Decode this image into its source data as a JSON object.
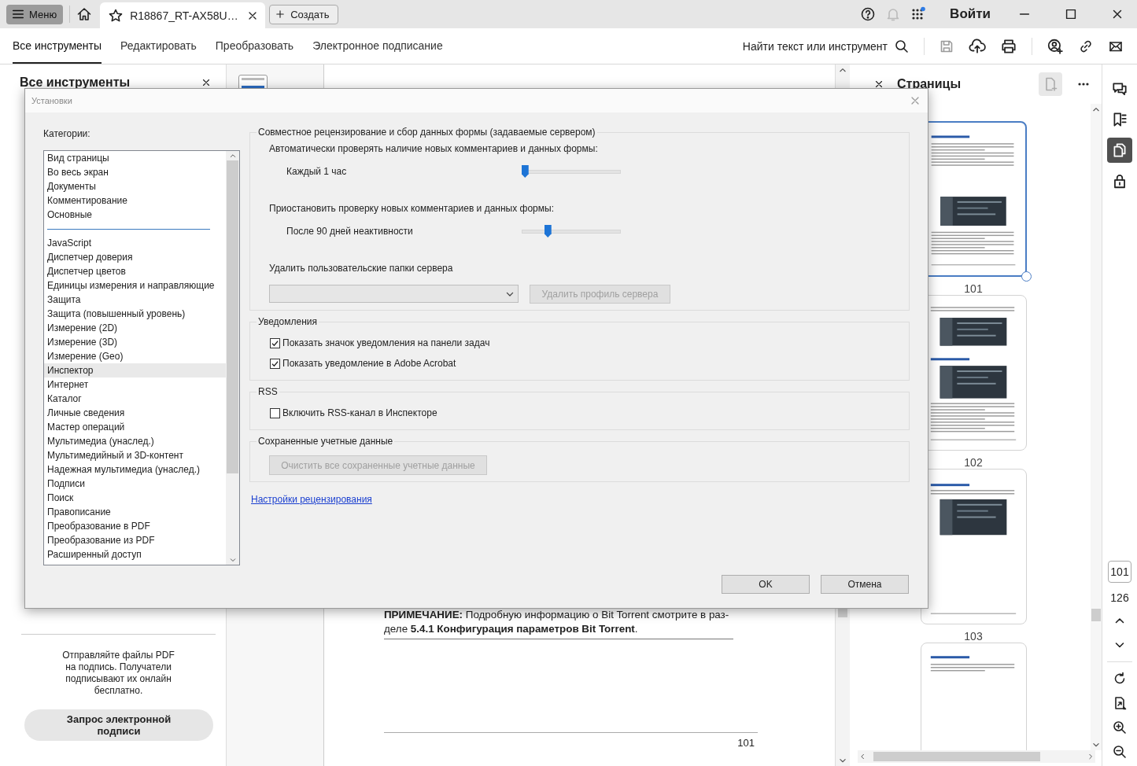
{
  "title_bar": {
    "menu_button": "Меню",
    "tab": {
      "title": "R18867_RT-AX58U…"
    },
    "create_button": "Создать",
    "sign_in": "Войти"
  },
  "toolbar": {
    "tabs": [
      {
        "label": "Все инструменты",
        "selected": true
      },
      {
        "label": "Редактировать",
        "selected": false
      },
      {
        "label": "Преобразовать",
        "selected": false
      },
      {
        "label": "Электронное подписание",
        "selected": false
      }
    ],
    "search": "Найти текст или инструмент"
  },
  "left_panel": {
    "title": "Все инструменты",
    "promo_text": "Отправляйте файлы PDF на подпись. Получатели подписывают их онлайн бесплатно.",
    "request_button": "Запрос электронной подписи"
  },
  "document": {
    "note": "**ПРИМЕЧАНИЕ:** Подробную информацию о Bit Torrent смотрите в раз-деле **5.4.1 Конфигурация параметров Bit Torrent**.",
    "page_number": "101"
  },
  "pages_panel": {
    "title": "Страницы",
    "pages": [
      {
        "number": "101",
        "selected": true
      },
      {
        "number": "102",
        "selected": false
      },
      {
        "number": "103",
        "selected": false
      },
      {
        "selected": false
      }
    ]
  },
  "rail": {
    "tools": [
      {
        "kind": "comments",
        "selected": false
      },
      {
        "kind": "bookmarks",
        "selected": false
      },
      {
        "kind": "pages",
        "selected": true
      },
      {
        "kind": "security",
        "selected": false
      }
    ],
    "page_field": "101",
    "page_count": "126"
  },
  "dialog": {
    "title": "Установки",
    "categories_label": "Категории:",
    "category_groups": [
      {
        "items": [
          {
            "label": "Вид страницы",
            "selected": false
          },
          {
            "label": "Во весь экран",
            "selected": false
          },
          {
            "label": "Документы",
            "selected": false
          },
          {
            "label": "Комментирование",
            "selected": false
          },
          {
            "label": "Основные",
            "selected": false
          }
        ]
      },
      {
        "items": [
          {
            "label": "JavaScript",
            "selected": false
          },
          {
            "label": "Диспетчер доверия",
            "selected": false
          },
          {
            "label": "Диспетчер цветов",
            "selected": false
          },
          {
            "label": "Единицы измерения и направляющие",
            "selected": false
          },
          {
            "label": "Защита",
            "selected": false
          },
          {
            "label": "Защита (повышенный уровень)",
            "selected": false
          },
          {
            "label": "Измерение (2D)",
            "selected": false
          },
          {
            "label": "Измерение (3D)",
            "selected": false
          },
          {
            "label": "Измерение (Geo)",
            "selected": false
          },
          {
            "label": "Инспектор",
            "selected": true
          },
          {
            "label": "Интернет",
            "selected": false
          },
          {
            "label": "Каталог",
            "selected": false
          },
          {
            "label": "Личные сведения",
            "selected": false
          },
          {
            "label": "Мастер операций",
            "selected": false
          },
          {
            "label": "Мультимедиа (унаслед.)",
            "selected": false
          },
          {
            "label": "Мультимедийный и 3D-контент",
            "selected": false
          },
          {
            "label": "Надежная мультимедиа (унаслед.)",
            "selected": false
          },
          {
            "label": "Подписи",
            "selected": false
          },
          {
            "label": "Поиск",
            "selected": false
          },
          {
            "label": "Правописание",
            "selected": false
          },
          {
            "label": "Преобразование в PDF",
            "selected": false
          },
          {
            "label": "Преобразование из PDF",
            "selected": false
          },
          {
            "label": "Расширенный доступ",
            "selected": false
          }
        ]
      }
    ],
    "sections": [
      {
        "legend": "Совместное рецензирование и сбор данных формы (задаваемые сервером)",
        "rows": [
          {
            "kind": "text",
            "text": "Автоматически проверять наличие новых комментариев и данных формы:"
          },
          {
            "kind": "slider",
            "label": "Каждый 1 час",
            "level": 0.03
          },
          {
            "kind": "text",
            "text": "Приостановить проверку новых комментариев и данных формы:"
          },
          {
            "kind": "slider",
            "label": "После 90 дней неактивности",
            "level": 0.26
          },
          {
            "kind": "text",
            "text": "Удалить пользовательские папки сервера"
          },
          {
            "kind": "select_button",
            "disabled": true,
            "button": "Удалить профиль сервера"
          }
        ]
      },
      {
        "legend": "Уведомления",
        "rows": [
          {
            "kind": "checkbox",
            "label": "Показать значок уведомления на панели задач",
            "checked": true
          },
          {
            "kind": "checkbox",
            "label": "Показать уведомление в Adobe Acrobat",
            "checked": true
          }
        ]
      },
      {
        "legend": "RSS",
        "rows": [
          {
            "kind": "checkbox",
            "label": "Включить RSS-канал в Инспекторе",
            "checked": false
          }
        ]
      },
      {
        "legend": "Сохраненные учетные данные",
        "rows": [
          {
            "kind": "button",
            "label": "Очистить все сохраненные учетные данные",
            "disabled": true
          }
        ]
      }
    ],
    "link": "Настройки рецензирования",
    "buttons": [
      "OK",
      "Отмена"
    ]
  }
}
